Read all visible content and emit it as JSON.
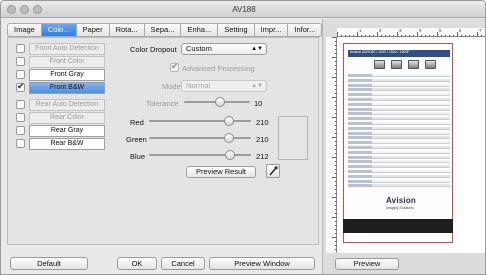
{
  "window": {
    "title": "AV188"
  },
  "tabs": [
    {
      "label": "Image",
      "active": false
    },
    {
      "label": "Colo...",
      "active": true
    },
    {
      "label": "Paper",
      "active": false
    },
    {
      "label": "Rota...",
      "active": false
    },
    {
      "label": "Sepa...",
      "active": false
    },
    {
      "label": "Enha...",
      "active": false
    },
    {
      "label": "Setting",
      "active": false
    },
    {
      "label": "Impr...",
      "active": false
    },
    {
      "label": "Infor...",
      "active": false
    }
  ],
  "scan_sides": [
    {
      "label": "Front Auto Detection",
      "checked": false,
      "enabled": false
    },
    {
      "label": "Front Color",
      "checked": false,
      "enabled": false
    },
    {
      "label": "Front Gray",
      "checked": false,
      "enabled": true
    },
    {
      "label": "Front B&W",
      "checked": true,
      "enabled": true,
      "selected": true
    },
    {
      "label": "Rear Auto Detection",
      "checked": false,
      "enabled": false
    },
    {
      "label": "Rear Color",
      "checked": false,
      "enabled": false
    },
    {
      "label": "Rear Gray",
      "checked": false,
      "enabled": true
    },
    {
      "label": "Rear B&W",
      "checked": false,
      "enabled": true
    }
  ],
  "color_dropout": {
    "label": "Color Dropout",
    "value": "Custom",
    "advanced_label": "Advanced Processing",
    "advanced_checked": true,
    "mode_label": "Mode",
    "mode_value": "Normal"
  },
  "sliders": {
    "tolerance": {
      "label": "Tolerance",
      "value": "10",
      "fraction": 0.55
    },
    "red": {
      "label": "Red",
      "value": "210",
      "fraction": 0.82
    },
    "green": {
      "label": "Green",
      "value": "210",
      "fraction": 0.82
    },
    "blue": {
      "label": "Blue",
      "value": "212",
      "fraction": 0.83
    }
  },
  "preview_result_label": "Preview Result",
  "bottom_buttons": {
    "default": "Default",
    "ok": "OK",
    "cancel": "Cancel",
    "preview_window": "Preview Window"
  },
  "preview": {
    "button_label": "Preview",
    "doc_title": "Avision AW1050 / 1000 / 1500 / 1500F",
    "brand": "Avision",
    "brand_sub": "Imaging Solutions",
    "ruler_numbers": [
      "1",
      "2",
      "3",
      "4",
      "5",
      "6",
      "7"
    ]
  },
  "colors": {
    "accent": "#3b82e4",
    "doc_border": "#d24a4a"
  }
}
